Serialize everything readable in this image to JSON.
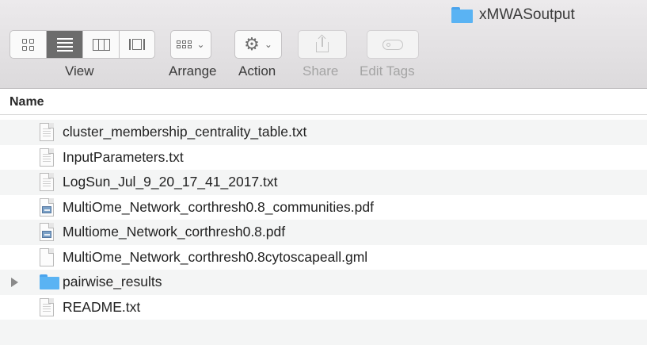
{
  "window": {
    "title": "xMWASoutput"
  },
  "toolbar": {
    "view_label": "View",
    "arrange_label": "Arrange",
    "action_label": "Action",
    "share_label": "Share",
    "edit_tags_label": "Edit Tags",
    "view_modes": [
      "icons",
      "list",
      "columns",
      "gallery"
    ],
    "selected_view": "list",
    "disabled": [
      "share",
      "edit-tags"
    ]
  },
  "columns": {
    "name": "Name"
  },
  "files": [
    {
      "name": "cluster_membership_centrality_table.txt",
      "icon": "text-document-icon"
    },
    {
      "name": "InputParameters.txt",
      "icon": "text-document-icon"
    },
    {
      "name": "LogSun_Jul_9_20_17_41_2017.txt",
      "icon": "text-document-icon"
    },
    {
      "name": "MultiOme_Network_corthresh0.8_communities.pdf",
      "icon": "pdf-document-icon"
    },
    {
      "name": "Multiome_Network_corthresh0.8.pdf",
      "icon": "pdf-document-icon"
    },
    {
      "name": "MultiOme_Network_corthresh0.8cytoscapeall.gml",
      "icon": "blank-document-icon"
    },
    {
      "name": "pairwise_results",
      "icon": "folder-icon",
      "expandable": true
    },
    {
      "name": "README.txt",
      "icon": "text-document-icon"
    }
  ],
  "colors": {
    "folder": "#5ab3f3",
    "selected_segment": "#6c6c6c",
    "row_alt": "#f4f5f5"
  }
}
